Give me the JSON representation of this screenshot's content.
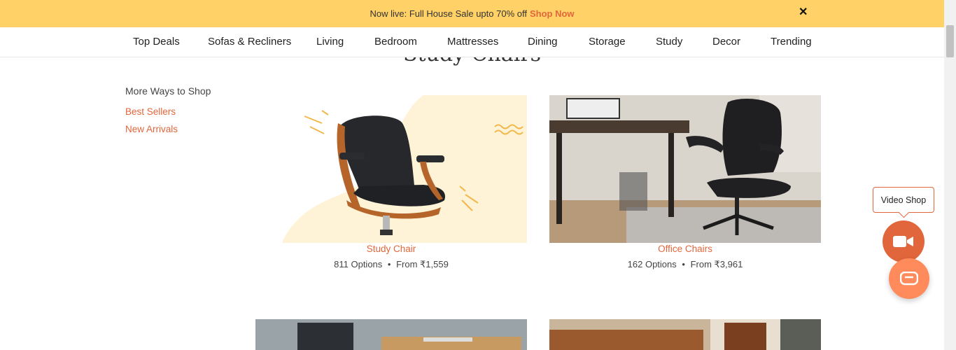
{
  "promo": {
    "text": "Now live: Full House Sale upto 70% off",
    "link": "Shop Now",
    "close_glyph": "✕"
  },
  "nav": {
    "items": [
      "Top Deals",
      "Sofas & Recliners",
      "Living",
      "Bedroom",
      "Mattresses",
      "Dining",
      "Storage",
      "Study",
      "Decor",
      "Trending"
    ]
  },
  "page": {
    "title": "Study Chairs"
  },
  "sidebar": {
    "title": "More Ways to Shop",
    "links": [
      "Best Sellers",
      "New Arrivals"
    ]
  },
  "products": [
    {
      "name": "Study Chair",
      "options": "811 Options",
      "sep": "•",
      "price": "From ₹1,559"
    },
    {
      "name": "Office Chairs",
      "options": "162 Options",
      "sep": "•",
      "price": "From ₹3,961"
    }
  ],
  "widgets": {
    "video_shop_label": "Video Shop",
    "video_icon": "video-camera-icon",
    "chat_icon": "chat-bubble-icon"
  },
  "colors": {
    "accent": "#e2663b",
    "promo_bg": "#ffd166"
  }
}
